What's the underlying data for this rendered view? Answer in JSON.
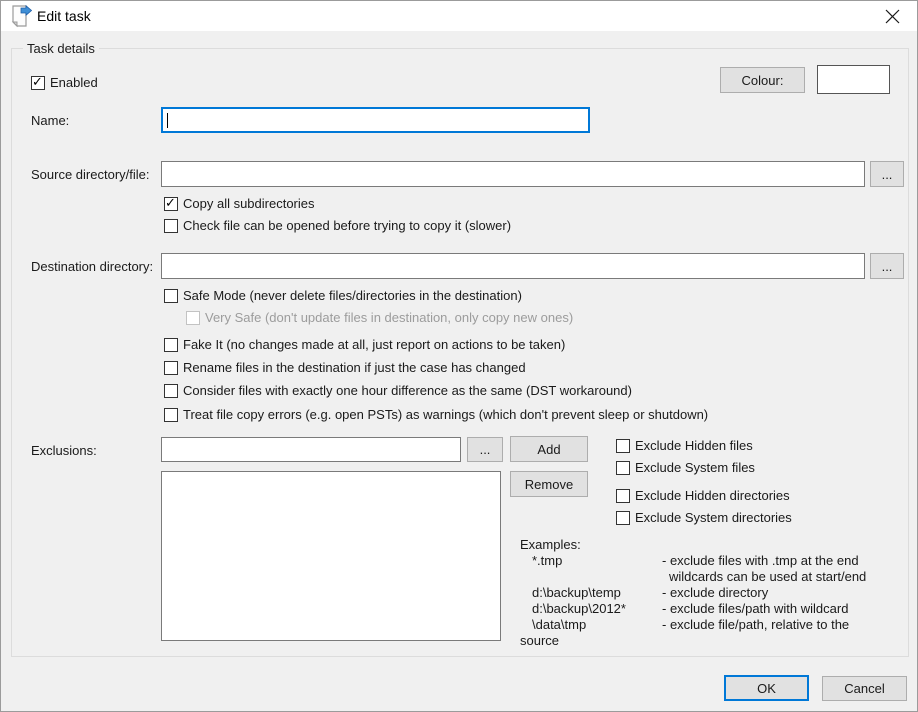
{
  "window": {
    "title": "Edit task"
  },
  "groupbox": {
    "title": "Task details"
  },
  "accent_color": "#0078d7",
  "enabled": {
    "label": "Enabled",
    "checked": true
  },
  "colour": {
    "button_label": "Colour:",
    "swatch_color": "#ffffff"
  },
  "name": {
    "label": "Name:",
    "value": ""
  },
  "source": {
    "label": "Source directory/file:",
    "value": "",
    "browse_label": "...",
    "options": {
      "copy_subdirectories": {
        "label": "Copy all subdirectories",
        "checked": true
      },
      "check_file": {
        "label": "Check file can be opened before trying to copy it (slower)",
        "checked": false
      }
    }
  },
  "destination": {
    "label": "Destination directory:",
    "value": "",
    "browse_label": "...",
    "options": {
      "safe_mode": {
        "label": "Safe Mode (never delete files/directories in the destination)",
        "checked": false
      },
      "very_safe": {
        "label": "Very Safe (don't update files in destination, only copy new ones)",
        "checked": false,
        "disabled": true
      },
      "fake_it": {
        "label": "Fake It (no changes made at all, just report on actions to be taken)",
        "checked": false
      },
      "rename_case": {
        "label": "Rename files in the destination if just the case has changed",
        "checked": false
      },
      "dst_workaround": {
        "label": "Consider files with exactly one hour difference as the same (DST workaround)",
        "checked": false
      },
      "treat_errors": {
        "label": "Treat file copy errors (e.g. open PSTs) as warnings (which don't prevent sleep or shutdown)",
        "checked": false
      }
    }
  },
  "exclusions": {
    "label": "Exclusions:",
    "value": "",
    "browse_label": "...",
    "add_label": "Add",
    "remove_label": "Remove",
    "list_items": [],
    "options": {
      "hidden_files": {
        "label": "Exclude Hidden files",
        "checked": false
      },
      "system_files": {
        "label": "Exclude System files",
        "checked": false
      },
      "hidden_directories": {
        "label": "Exclude Hidden directories",
        "checked": false
      },
      "system_directories": {
        "label": "Exclude System directories",
        "checked": false
      }
    }
  },
  "examples": {
    "title": "Examples:",
    "rows": [
      {
        "pattern": "*.tmp",
        "desc": "- exclude files with .tmp at the end"
      },
      {
        "pattern": "",
        "desc": "wildcards can be used at start/end"
      },
      {
        "pattern": "d:\\backup\\temp",
        "desc": "- exclude directory"
      },
      {
        "pattern": "d:\\backup\\2012*",
        "desc": "- exclude files/path with wildcard"
      },
      {
        "pattern": "\\data\\tmp",
        "desc": "- exclude file/path, relative to the"
      }
    ],
    "footer": "source"
  },
  "buttons": {
    "ok": "OK",
    "cancel": "Cancel"
  }
}
